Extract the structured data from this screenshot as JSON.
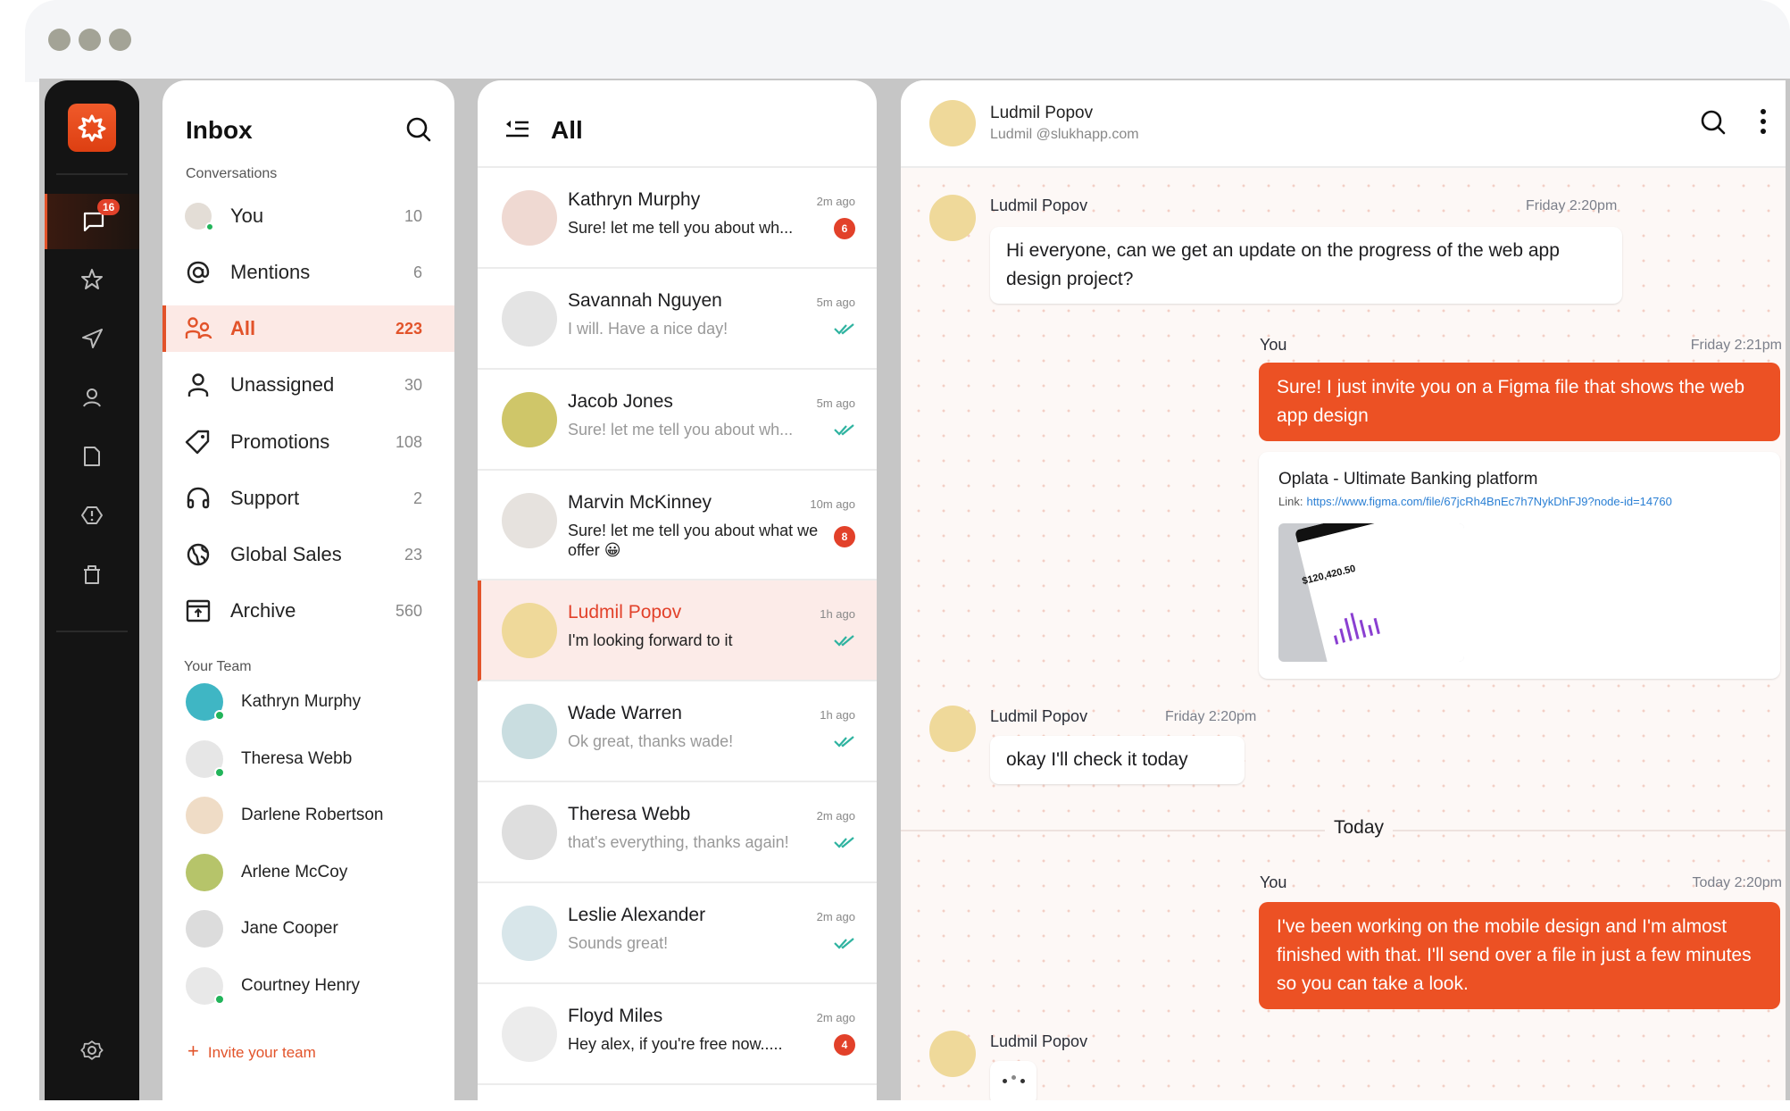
{
  "rail": {
    "logo": "app-logo",
    "items": [
      {
        "icon": "chat-bubble-icon",
        "badge": "16",
        "active": true
      },
      {
        "icon": "star-icon"
      },
      {
        "icon": "send-icon"
      },
      {
        "icon": "user-icon"
      },
      {
        "icon": "file-icon"
      },
      {
        "icon": "alert-icon"
      },
      {
        "icon": "trash-icon"
      }
    ],
    "settings_icon": "gear-icon"
  },
  "inbox": {
    "title": "Inbox",
    "conversations_label": "Conversations",
    "items": [
      {
        "label": "You",
        "count": "10",
        "icon": "user-avatar"
      },
      {
        "label": "Mentions",
        "count": "6",
        "icon": "at-icon"
      },
      {
        "label": "All",
        "count": "223",
        "icon": "users-icon",
        "active": true
      },
      {
        "label": "Unassigned",
        "count": "30",
        "icon": "user-outline-icon"
      },
      {
        "label": "Promotions",
        "count": "108",
        "icon": "tag-icon"
      },
      {
        "label": "Support",
        "count": "2",
        "icon": "headphones-icon"
      },
      {
        "label": "Global Sales",
        "count": "23",
        "icon": "globe-icon"
      },
      {
        "label": "Archive",
        "count": "560",
        "icon": "archive-icon"
      }
    ],
    "team_label": "Your Team",
    "team": [
      {
        "name": "Kathryn Murphy",
        "online": true,
        "color": "#3fb6c4"
      },
      {
        "name": "Theresa Webb",
        "online": true,
        "color": "#e6e6e6"
      },
      {
        "name": "Darlene Robertson",
        "online": false,
        "color": "#efdcc6"
      },
      {
        "name": "Arlene McCoy",
        "online": false,
        "color": "#b6c46a"
      },
      {
        "name": "Jane Cooper",
        "online": false,
        "color": "#dcdcdc"
      },
      {
        "name": "Courtney Henry",
        "online": true,
        "color": "#e8e8e8"
      }
    ],
    "invite_label": "Invite your team"
  },
  "list": {
    "title": "All",
    "conversations": [
      {
        "name": "Kathryn Murphy",
        "time": "2m ago",
        "preview": "Sure! let me tell you about wh...",
        "unread": "6",
        "avatar_color": "#efd9d2"
      },
      {
        "name": "Savannah Nguyen",
        "time": "5m ago",
        "preview": "I will. Have a nice day!",
        "read": true,
        "avatar_color": "#e4e4e4"
      },
      {
        "name": "Jacob Jones",
        "time": "5m ago",
        "preview": "Sure! let me tell you about wh...",
        "read": true,
        "avatar_color": "#cfc669"
      },
      {
        "name": "Marvin McKinney",
        "time": "10m ago",
        "preview": "Sure! let me tell you about what we offer 😀",
        "unread": "8",
        "avatar_color": "#e6e2de"
      },
      {
        "name": "Ludmil Popov",
        "time": "1h ago",
        "preview": "I'm looking forward to it",
        "read": true,
        "active": true,
        "avatar_color": "#efd99a"
      },
      {
        "name": "Wade Warren",
        "time": "1h ago",
        "preview": "Ok great, thanks wade!",
        "read": true,
        "avatar_color": "#c9dde0"
      },
      {
        "name": "Theresa Webb",
        "time": "2m ago",
        "preview": "that's everything, thanks again!",
        "read": true,
        "avatar_color": "#dedede"
      },
      {
        "name": "Leslie Alexander",
        "time": "2m ago",
        "preview": "Sounds great!",
        "read": true,
        "avatar_color": "#d8e6ea"
      },
      {
        "name": "Floyd Miles",
        "time": "2m ago",
        "preview": "Hey alex, if you're free now.....",
        "unread": "4",
        "avatar_color": "#ececec"
      }
    ]
  },
  "chat": {
    "contact_name": "Ludmil Popov",
    "contact_email": "Ludmil @slukhapp.com",
    "messages": [
      {
        "sender": "Ludmil Popov",
        "time": "Friday 2:20pm",
        "text": "Hi everyone, can we get an update on the progress of the web app design project?",
        "direction": "in"
      },
      {
        "sender": "You",
        "time": "Friday 2:21pm",
        "text": "Sure! I just invite you on a Figma file that shows the web app design",
        "direction": "out"
      },
      {
        "sender": "Ludmil Popov",
        "time": "Friday 2:20pm",
        "text": "okay I'll check it today",
        "direction": "in"
      },
      {
        "sender": "You",
        "time": "Today 2:20pm",
        "text": "I've been working on the mobile design and I'm almost finished with that. I'll send over a file in just a few minutes so you can take a look.",
        "direction": "out"
      },
      {
        "sender": "Ludmil Popov",
        "typing": true,
        "direction": "in"
      }
    ],
    "link_card": {
      "title": "Oplata - Ultimate Banking platform",
      "link_label": "Link:",
      "url": "https://www.figma.com/file/67jcRh4BnEc7h7NykDhFJ9?node-id=14760",
      "preview_amount": "$120,420.50"
    },
    "divider": "Today"
  },
  "colors": {
    "accent": "#e2532a",
    "outgoing_bubble": "#ec5124",
    "badge": "#e2412a",
    "online": "#22b45a",
    "read_check": "#2fb3a0",
    "rail_bg": "#141414"
  }
}
